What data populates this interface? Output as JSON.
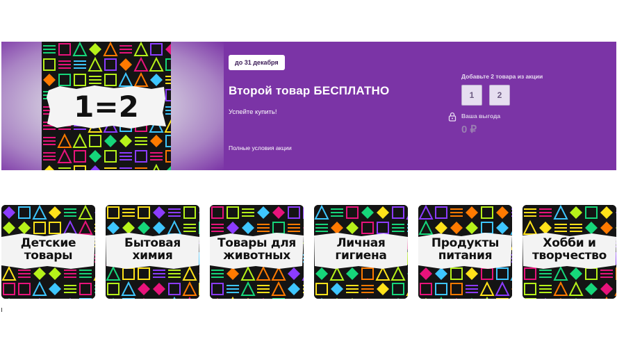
{
  "promo": {
    "art_text": "1=2",
    "deadline": "до 31 декабря",
    "title": "Второй товар БЕСПЛАТНО",
    "subtitle": "Успейте купить!",
    "terms_link": "Полные условия акции",
    "add_hint": "Добавьте 2 товара из акции",
    "slots": [
      "1",
      "2"
    ],
    "benefit_label": "Ваша выгода",
    "benefit_value": "0 ₽",
    "lock_icon": "lock-icon",
    "colors": {
      "background": "#7b34a6",
      "text": "#ffffff"
    }
  },
  "categories": [
    {
      "label": "Детские товары",
      "lines": [
        "Детские",
        "товары"
      ]
    },
    {
      "label": "Бытовая химия",
      "lines": [
        "Бытовая",
        "химия"
      ]
    },
    {
      "label": "Товары для животных",
      "lines": [
        "Товары для",
        "животных"
      ]
    },
    {
      "label": "Личная гигиена",
      "lines": [
        "Личная",
        "гигиена"
      ]
    },
    {
      "label": "Продукты питания",
      "lines": [
        "Продукты",
        "питания"
      ]
    },
    {
      "label": "Хобби и творчество",
      "lines": [
        "Хобби и",
        "творчество"
      ]
    }
  ]
}
